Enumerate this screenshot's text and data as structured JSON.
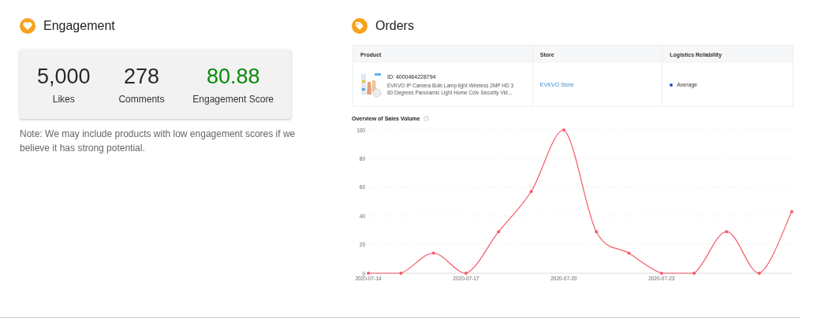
{
  "engagement": {
    "title": "Engagement",
    "stats": [
      {
        "value": "5,000",
        "label": "Likes",
        "kind": "plain"
      },
      {
        "value": "278",
        "label": "Comments",
        "kind": "plain"
      },
      {
        "value": "80.88",
        "label": "Engagement Score",
        "kind": "score"
      }
    ],
    "note": "Note: We may include products with low engagement scores if we believe it has strong potential."
  },
  "orders": {
    "title": "Orders",
    "table": {
      "columns": [
        "Product",
        "Store",
        "Logistics Reliability"
      ],
      "rows": [
        {
          "product_id": "ID: 4000464228794",
          "product_name": "EVKVO IP Camera Bulb Lamp light Wireless 2MP HD 3 60 Degrees Panoramic Light Home Cctv Security Vid...",
          "store": "EVKVO Store",
          "logistics": "Average",
          "color": "#1f4fd8"
        }
      ]
    },
    "chart_title": "Overview of Sales Volume",
    "chart_data": {
      "type": "line",
      "categories": [
        "2020-07-14",
        null,
        null,
        "2020-07-17",
        null,
        null,
        "2020-07-20",
        null,
        null,
        "2020-07-23",
        null,
        null,
        null,
        null
      ],
      "grid": true,
      "series": [
        {
          "color": "#f55a68",
          "values": [
            0,
            0,
            14,
            0,
            29,
            57,
            100,
            29,
            14,
            0,
            0,
            29,
            0,
            43
          ]
        }
      ],
      "ylim": [
        0,
        100
      ],
      "yticks": [
        0,
        20,
        40,
        60,
        80,
        100
      ]
    }
  }
}
